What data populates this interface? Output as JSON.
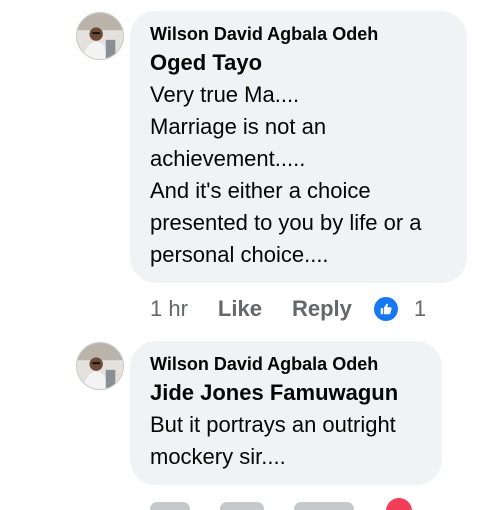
{
  "comments": [
    {
      "author": "Wilson David Agbala Odeh",
      "mention": "Oged Tayo",
      "lines": [
        "Very true Ma....",
        "Marriage is not an",
        "achievement.....",
        "And it's either a choice",
        "presented to you by life or a",
        "personal choice...."
      ],
      "time": "1 hr",
      "like_label": "Like",
      "reply_label": "Reply",
      "reaction_count": "1",
      "reaction_icon": "thumbs-up-icon",
      "reaction_color": "#1877f2"
    },
    {
      "author": "Wilson David Agbala Odeh",
      "mention": "Jide Jones Famuwagun",
      "lines": [
        "But it portrays an outright",
        "mockery sir...."
      ]
    }
  ],
  "colors": {
    "bubble": "#f0f2f5",
    "meta_text": "#65676b",
    "text": "#050505",
    "heart": "#f33e58"
  }
}
